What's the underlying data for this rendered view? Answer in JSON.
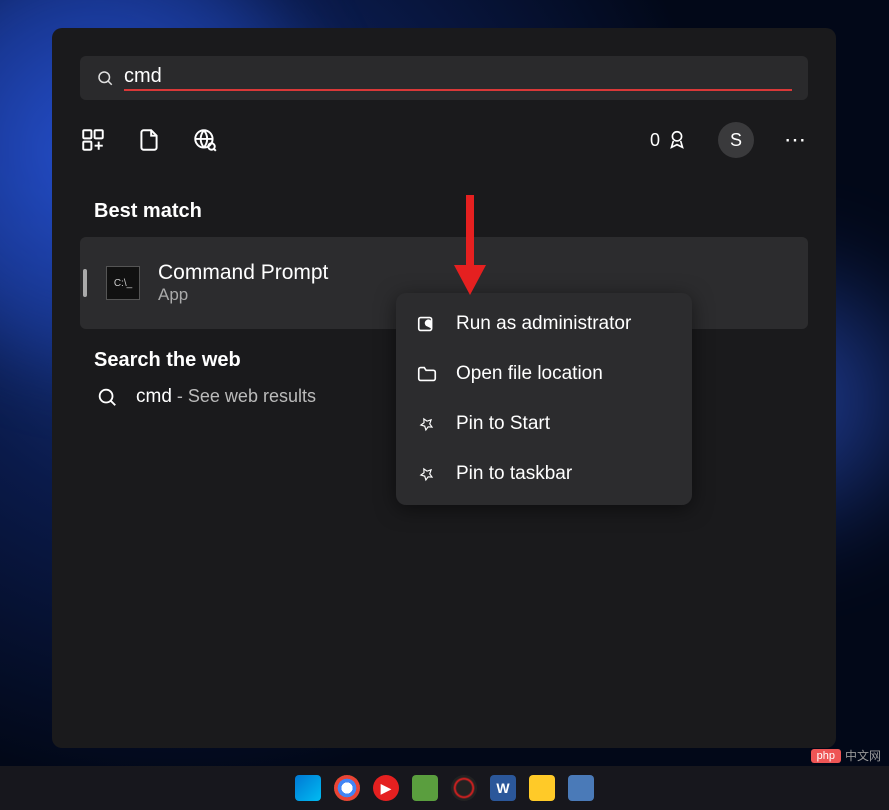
{
  "search": {
    "value": "cmd"
  },
  "header": {
    "rewards_count": "0",
    "avatar_initial": "S"
  },
  "sections": {
    "best_match": "Best match",
    "search_web": "Search the web"
  },
  "best_match": {
    "title": "Command Prompt",
    "subtitle": "App"
  },
  "web": {
    "term": "cmd",
    "suffix": " - See web results"
  },
  "context": {
    "items": [
      {
        "label": "Run as administrator"
      },
      {
        "label": "Open file location"
      },
      {
        "label": "Pin to Start"
      },
      {
        "label": "Pin to taskbar"
      }
    ]
  },
  "watermark": {
    "badge": "php",
    "text": "中文网"
  }
}
